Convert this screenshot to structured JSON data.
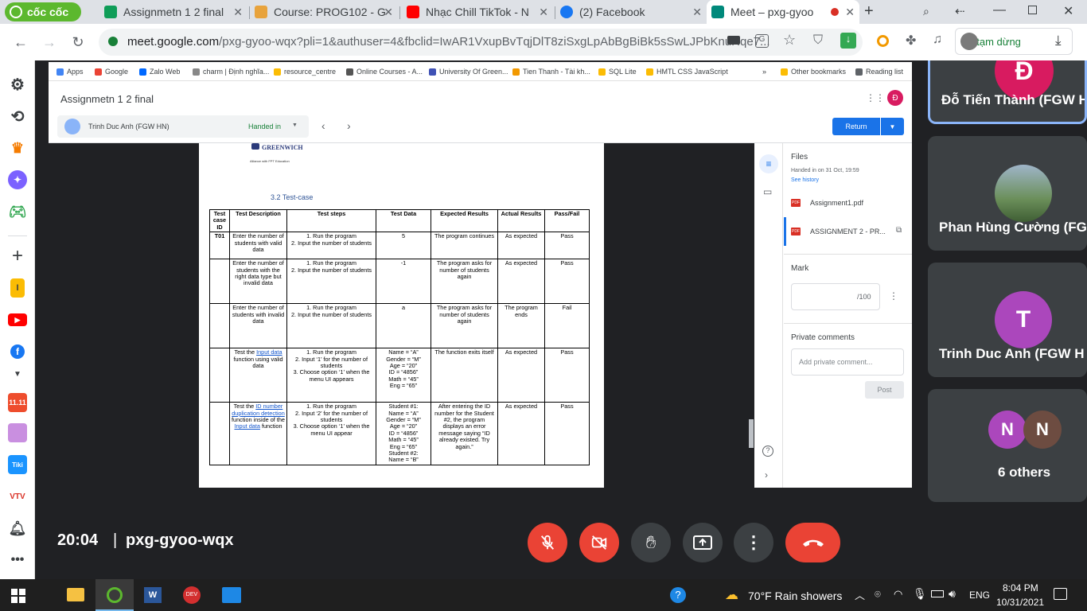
{
  "browser": {
    "brand": "cốc cốc",
    "tabs": [
      {
        "title": "Assignmetn 1 2 final",
        "icon": "classroom-icon"
      },
      {
        "title": "Course: PROG102 - G",
        "icon": "course-icon"
      },
      {
        "title": "Nhạc Chill TikTok - N",
        "icon": "youtube-icon"
      },
      {
        "title": "(2) Facebook",
        "icon": "facebook-icon"
      },
      {
        "title": "Meet – pxg-gyoo",
        "icon": "meet-icon",
        "active": true
      }
    ],
    "url_host": "meet.google.com",
    "url_rest": "/pxg-gyoo-wqx?pli=1&authuser=4&fbclid=IwAR1VxupBvTqjDlT8ziSxgLpAbBgBiBk5sSwLJPbKnuHqe7...",
    "profile_status": "Đã tạm dừng"
  },
  "shared_screen": {
    "bookmarks": [
      "Apps",
      "Google",
      "Zalo Web",
      "charm | Định nghĩa...",
      "resource_centre",
      "Online Courses - A...",
      "University Of Green...",
      "Tien Thanh - Tài kh...",
      "SQL Lite",
      "HMTL CSS JavaScript",
      "»",
      "Other bookmarks",
      "Reading list"
    ],
    "assignment_title": "Assignmetn 1 2 final",
    "account_initial": "Đ",
    "student_name": "Trinh Duc Anh (FGW HN)",
    "student_status": "Handed in",
    "return_label": "Return",
    "doc": {
      "logo_text": "GREENWICH",
      "logo_sub": "Alliance with FPT Education",
      "section_heading": "3.2 Test-case",
      "columns": [
        "Test case ID",
        "Test Description",
        "Test steps",
        "Test Data",
        "Expected Results",
        "Actual Results",
        "Pass/Fail"
      ],
      "rows": [
        {
          "id": "T01",
          "desc": "Enter the number of students with valid data",
          "steps": "1. Run the program\n2. Input the number of students",
          "data": "5",
          "expected": "The program continues",
          "actual": "As expected",
          "result": "Pass"
        },
        {
          "id": "",
          "desc": "Enter the number of students with the right data type but invalid data",
          "steps": "1. Run the program\n2. Input the number of students",
          "data": "-1",
          "expected": "The program asks for number of students again",
          "actual": "As expected",
          "result": "Pass"
        },
        {
          "id": "",
          "desc": "Enter the number of students with invalid data",
          "steps": "1. Run the program\n2. Input the number of students",
          "data": "a",
          "expected": "The program asks for number of students again",
          "actual": "The program ends",
          "result": "Fail"
        },
        {
          "id": "",
          "desc_pre": "Test the ",
          "desc_link": "Input data",
          "desc_post": " function using valid data",
          "steps": "1. Run the program\n2. Input ‘1’ for the number of students\n3. Choose option ‘1’ when the menu UI appears",
          "data": "Name = “A”\nGender = “M”\nAge = “20”\nID = “4856”\nMath = “45”\nEng = “65”",
          "expected": "The function exits itself",
          "actual": "As expected",
          "result": "Pass"
        },
        {
          "id": "",
          "desc_pre": "Test the ",
          "desc_link": "ID number duplication detection",
          "desc_post": " function inside of the ",
          "desc_link2": "Input data",
          "desc_post2": " function",
          "steps": "1. Run the program\n2. Input ‘2’ for the number of students\n3. Choose option ‘1’ when the menu UI appear",
          "data": "Student #1:\nName = “A”\nGender = “M”\nAge = “20”\nID = “4856”\nMath = “45”\nEng = “65”\nStudent #2:\nName = “B”",
          "expected": "After entering the ID number for the Student #2, the program displays an error message saying “ID already existed. Try again.”",
          "actual": "As expected",
          "result": "Pass"
        }
      ]
    },
    "grading": {
      "files_heading": "Files",
      "handed_in": "Handed in on 31 Oct, 19:59",
      "see_history": "See history",
      "files": [
        "Assignment1.pdf",
        "ASSIGNMENT 2 - PR..."
      ],
      "mark_heading": "Mark",
      "mark_suffix": "/100",
      "private_heading": "Private comments",
      "comment_placeholder": "Add private comment...",
      "post_label": "Post"
    }
  },
  "participants": [
    {
      "name": "Đỗ Tiến Thành (FGW H",
      "initial": "Đ",
      "color": "#d81b60"
    },
    {
      "name": "Phan Hùng Cường (FG",
      "initial": "",
      "color": "#6b8f5a"
    },
    {
      "name": "Trinh Duc Anh (FGW H",
      "initial": "T",
      "color": "#ab47bc"
    },
    {
      "name": "6 others",
      "initials": [
        "N",
        "N"
      ],
      "colors": [
        "#ab47bc",
        "#6d4c41"
      ]
    }
  ],
  "meeting": {
    "time": "20:04",
    "separator": "|",
    "code": "pxg-gyoo-wqx"
  },
  "taskbar": {
    "weather": "70°F  Rain showers",
    "language": "ENG",
    "time": "8:04 PM",
    "date": "10/31/2021"
  }
}
